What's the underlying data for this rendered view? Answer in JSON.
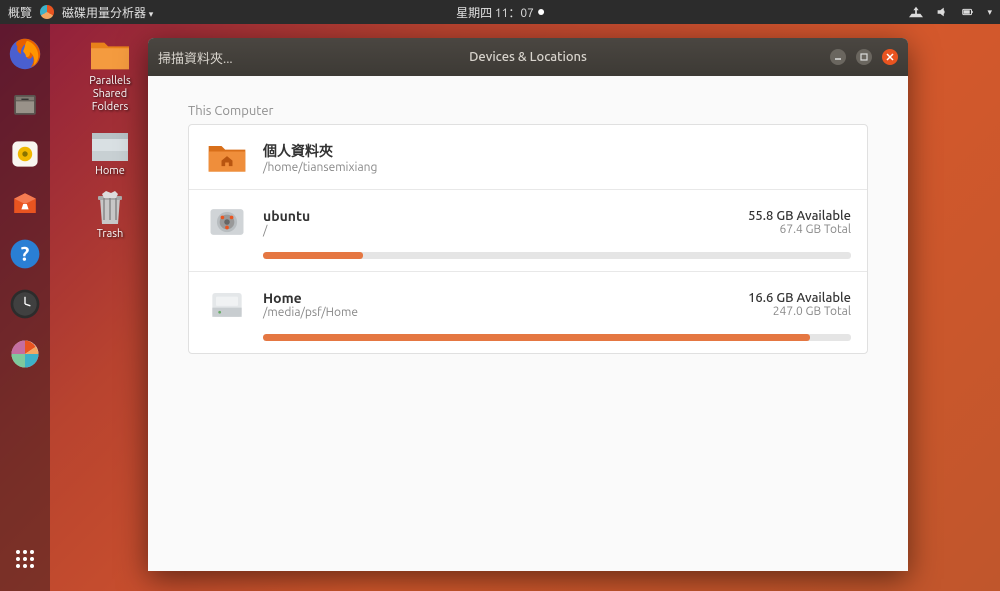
{
  "topbar": {
    "overview": "概覽",
    "app_name": "磁碟用量分析器",
    "date": "星期四 11：07"
  },
  "desktop": {
    "icons": [
      {
        "label": "Parallels Shared Folders"
      },
      {
        "label": "Home"
      },
      {
        "label": "Trash"
      }
    ]
  },
  "window": {
    "menu": "掃描資料夾...",
    "title": "Devices & Locations",
    "section": "This Computer",
    "items": [
      {
        "name": "個人資料夾",
        "path": "/home/tiansemixiang",
        "available": "",
        "total": "",
        "progress_pct": 0,
        "has_progress": false,
        "icon": "folder-home"
      },
      {
        "name": "ubuntu",
        "path": "/",
        "available": "55.8 GB Available",
        "total": "67.4 GB Total",
        "progress_pct": 17,
        "has_progress": true,
        "icon": "drive-ubuntu"
      },
      {
        "name": "Home",
        "path": "/media/psf/Home",
        "available": "16.6 GB Available",
        "total": "247.0 GB Total",
        "progress_pct": 93,
        "has_progress": true,
        "icon": "drive-external"
      }
    ]
  }
}
